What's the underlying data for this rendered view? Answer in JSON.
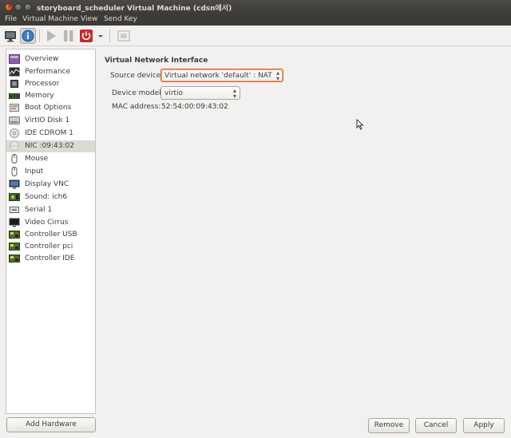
{
  "window": {
    "title": "storyboard_scheduler Virtual Machine (cdsn에서)",
    "close_glyph": "×"
  },
  "menubar": {
    "items": [
      "File",
      "Virtual Machine",
      "View",
      "Send Key"
    ]
  },
  "toolbar": {
    "buttons": [
      {
        "icon": "console-monitor-icon",
        "active": false
      },
      {
        "icon": "info-icon",
        "active": true
      },
      {
        "icon": "play-icon",
        "active": false
      },
      {
        "icon": "pause-icon",
        "active": false
      },
      {
        "icon": "power-icon",
        "active": false
      },
      {
        "icon": "chevron-down-icon",
        "active": false
      },
      {
        "icon": "fullscreen-icon",
        "active": false
      }
    ]
  },
  "sidebar": {
    "items": [
      {
        "label": "Overview",
        "icon": "overview-icon"
      },
      {
        "label": "Performance",
        "icon": "performance-icon"
      },
      {
        "label": "Processor",
        "icon": "processor-icon"
      },
      {
        "label": "Memory",
        "icon": "memory-icon"
      },
      {
        "label": "Boot Options",
        "icon": "boot-options-icon"
      },
      {
        "label": "VirtIO Disk 1",
        "icon": "disk-icon"
      },
      {
        "label": "IDE CDROM 1",
        "icon": "cdrom-icon"
      },
      {
        "label": "NIC :09:43:02",
        "icon": "nic-icon",
        "selected": true
      },
      {
        "label": "Mouse",
        "icon": "mouse-icon"
      },
      {
        "label": "Input",
        "icon": "input-icon"
      },
      {
        "label": "Display VNC",
        "icon": "display-icon"
      },
      {
        "label": "Sound: ich6",
        "icon": "sound-icon"
      },
      {
        "label": "Serial 1",
        "icon": "serial-icon"
      },
      {
        "label": "Video Cirrus",
        "icon": "video-icon"
      },
      {
        "label": "Controller USB",
        "icon": "controller-icon"
      },
      {
        "label": "Controller pci",
        "icon": "controller-icon"
      },
      {
        "label": "Controller IDE",
        "icon": "controller-icon"
      }
    ],
    "add_hardware_label": "Add Hardware"
  },
  "details": {
    "heading": "Virtual Network Interface",
    "source_device_label": "Source device:",
    "source_device_value": "Virtual network 'default' : NAT",
    "device_model_label": "Device model:",
    "device_model_value": "virtio",
    "mac_label": "MAC address:",
    "mac_value": "52:54:00:09:43:02"
  },
  "actions": {
    "remove_label": "Remove",
    "cancel_label": "Cancel",
    "apply_label": "Apply"
  },
  "colors": {
    "accent": "#e2622e",
    "selection": "#dcdad5",
    "titlebar": "#3c3b37"
  }
}
